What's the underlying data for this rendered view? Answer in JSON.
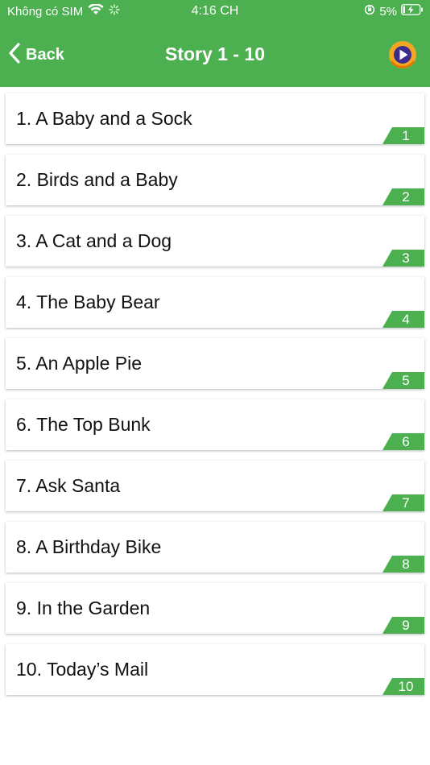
{
  "status_bar": {
    "carrier": "Không có SIM",
    "time": "4:16 CH",
    "battery": "5%"
  },
  "nav": {
    "back_label": "Back",
    "title": "Story 1 - 10"
  },
  "stories": [
    {
      "title": "1. A Baby and a Sock",
      "badge": "1"
    },
    {
      "title": "2. Birds and a Baby",
      "badge": "2"
    },
    {
      "title": "3. A Cat and a Dog",
      "badge": "3"
    },
    {
      "title": "4. The Baby Bear",
      "badge": "4"
    },
    {
      "title": "5. An Apple Pie",
      "badge": "5"
    },
    {
      "title": "6. The Top Bunk",
      "badge": "6"
    },
    {
      "title": "7. Ask Santa",
      "badge": "7"
    },
    {
      "title": "8. A Birthday Bike",
      "badge": "8"
    },
    {
      "title": "9. In the Garden",
      "badge": "9"
    },
    {
      "title": "10. Today’s Mail",
      "badge": "10"
    }
  ],
  "colors": {
    "accent": "#4caf50",
    "play_button": "#f5a623",
    "play_button_inner": "#3d2c8d"
  },
  "icons": {
    "wifi": "wifi-icon",
    "loading": "loading-spinner-icon",
    "orientation_lock": "orientation-lock-icon",
    "battery": "battery-charging-icon",
    "back": "chevron-left-icon",
    "play": "play-circle-icon"
  }
}
